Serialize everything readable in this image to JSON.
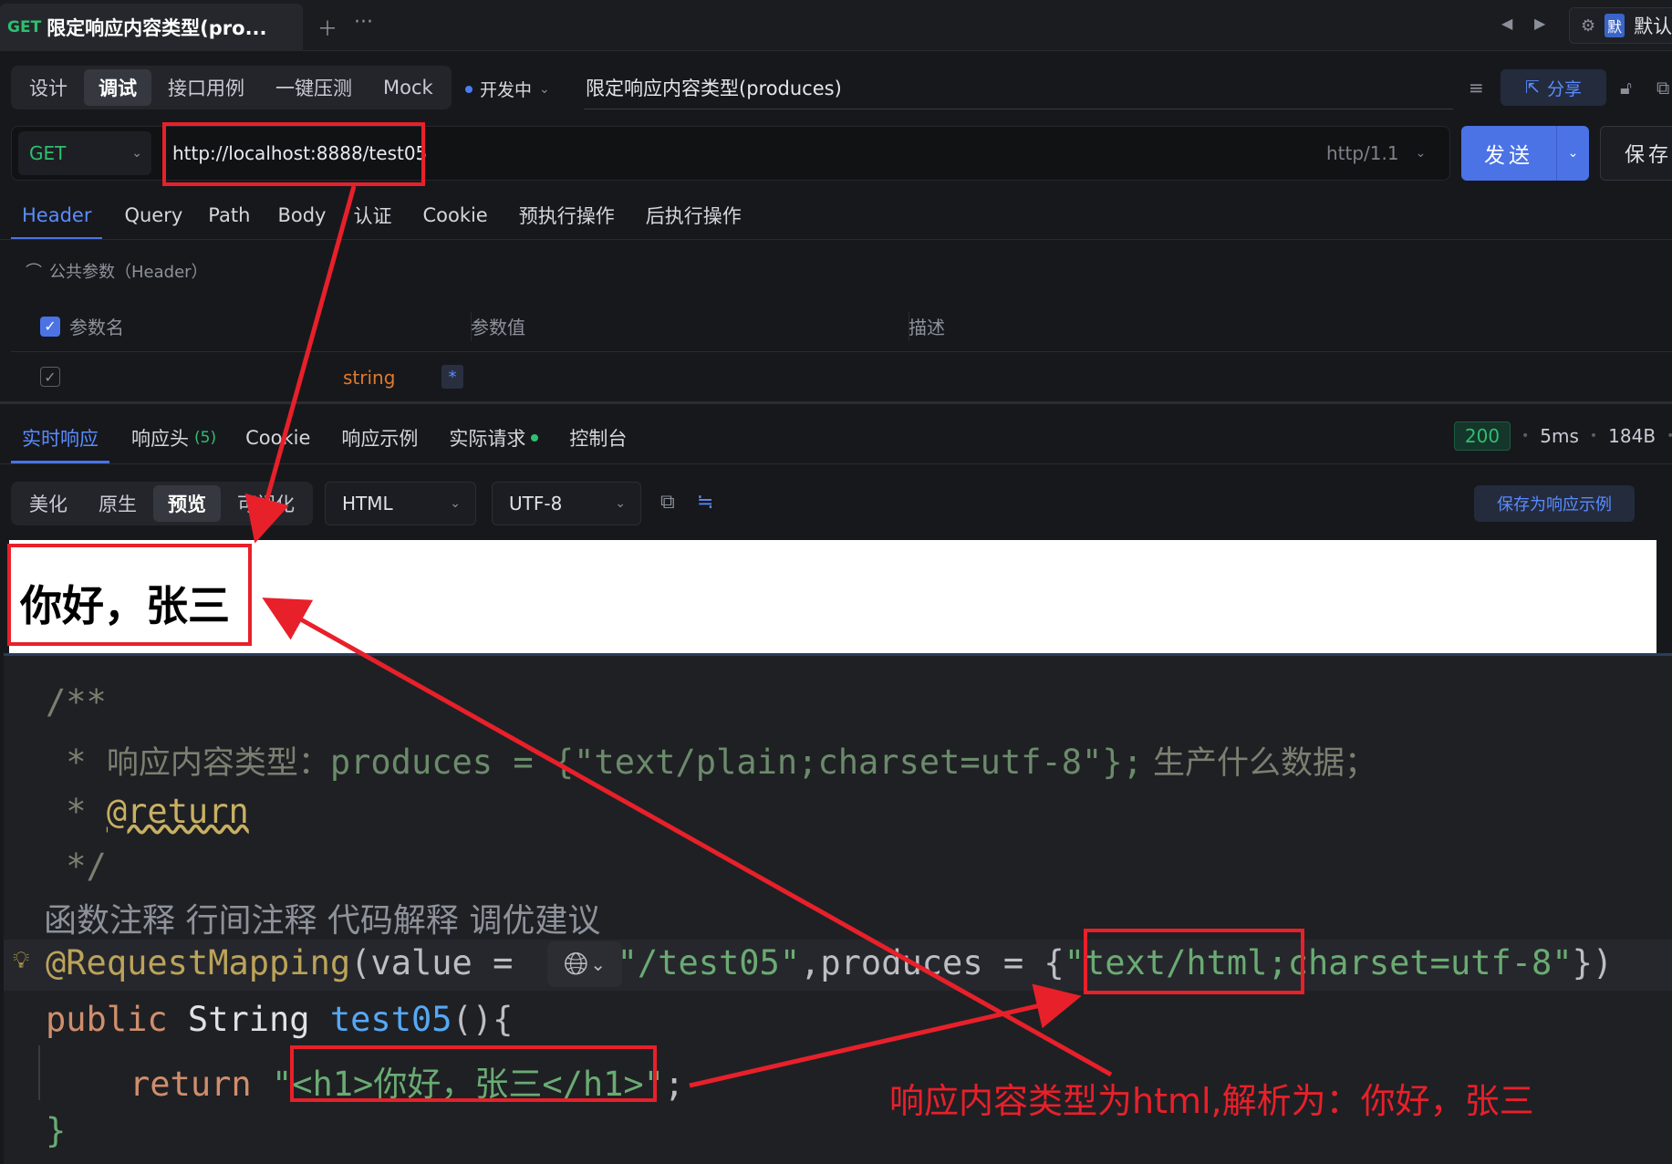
{
  "tabbar": {
    "method": "GET",
    "title": "限定响应内容类型(pro...",
    "add_icon": "plus-icon",
    "more_icon": "ellipsis-icon",
    "env_badge": "默",
    "env_label": "默认"
  },
  "modes": [
    "设计",
    "调试",
    "接口用例",
    "一键压测",
    "Mock"
  ],
  "active_mode": "调试",
  "status": "开发中",
  "api_name": "限定响应内容类型(produces)",
  "share_label": "分享",
  "request": {
    "method": "GET",
    "url": "http://localhost:8888/test05",
    "protocol": "http/1.1",
    "send_label": "发送",
    "save_label": "保存"
  },
  "request_tabs": [
    "Header",
    "Query",
    "Path",
    "Body",
    "认证",
    "Cookie",
    "预执行操作",
    "后执行操作"
  ],
  "common_params_label": "公共参数（Header）",
  "param_table": {
    "headers": [
      "参数名",
      "参数值",
      "描述"
    ],
    "row": {
      "type": "string",
      "required_mark": "*"
    }
  },
  "response_tabs": [
    {
      "label": "实时响应"
    },
    {
      "label": "响应头",
      "count": "(5)"
    },
    {
      "label": "Cookie"
    },
    {
      "label": "响应示例"
    },
    {
      "label": "实际请求"
    },
    {
      "label": "控制台"
    }
  ],
  "response_meta": {
    "status_code": "200",
    "time": "5ms",
    "size": "184B"
  },
  "view_modes": [
    "美化",
    "原生",
    "预览",
    "可视化"
  ],
  "active_view": "预览",
  "format": "HTML",
  "encoding": "UTF-8",
  "save_example_label": "保存为响应示例",
  "preview_heading": "你好，张三",
  "code": {
    "l1": "/**",
    "l2_star": " * ",
    "l2_text": "响应内容类型：",
    "l2_code": "produces = {\"text/plain;charset=utf-8\"};",
    "l2_tail": " 生产什么数据；",
    "l3_star": " * ",
    "l3_tag": "@return",
    "l4": " */",
    "inlay": "函数注释  行间注释  代码解释  调优建议",
    "l5_ann": "@RequestMapping",
    "l5_a": "(value = ",
    "l5_path": "\"/test05\"",
    "l5_b": ",produces = {",
    "l5_str": "\"text/html;charset=utf-8\"",
    "l5_c": "})",
    "l6_kw": "public",
    "l6_type": " String ",
    "l6_fn": "test05",
    "l6_rest": "(){",
    "l7_kw": "return",
    "l7_str": "\"<h1>你好，张三</h1>\"",
    "l7_end": ";",
    "l8": "}"
  },
  "annotation": "响应内容类型为html,解析为：你好，张三"
}
